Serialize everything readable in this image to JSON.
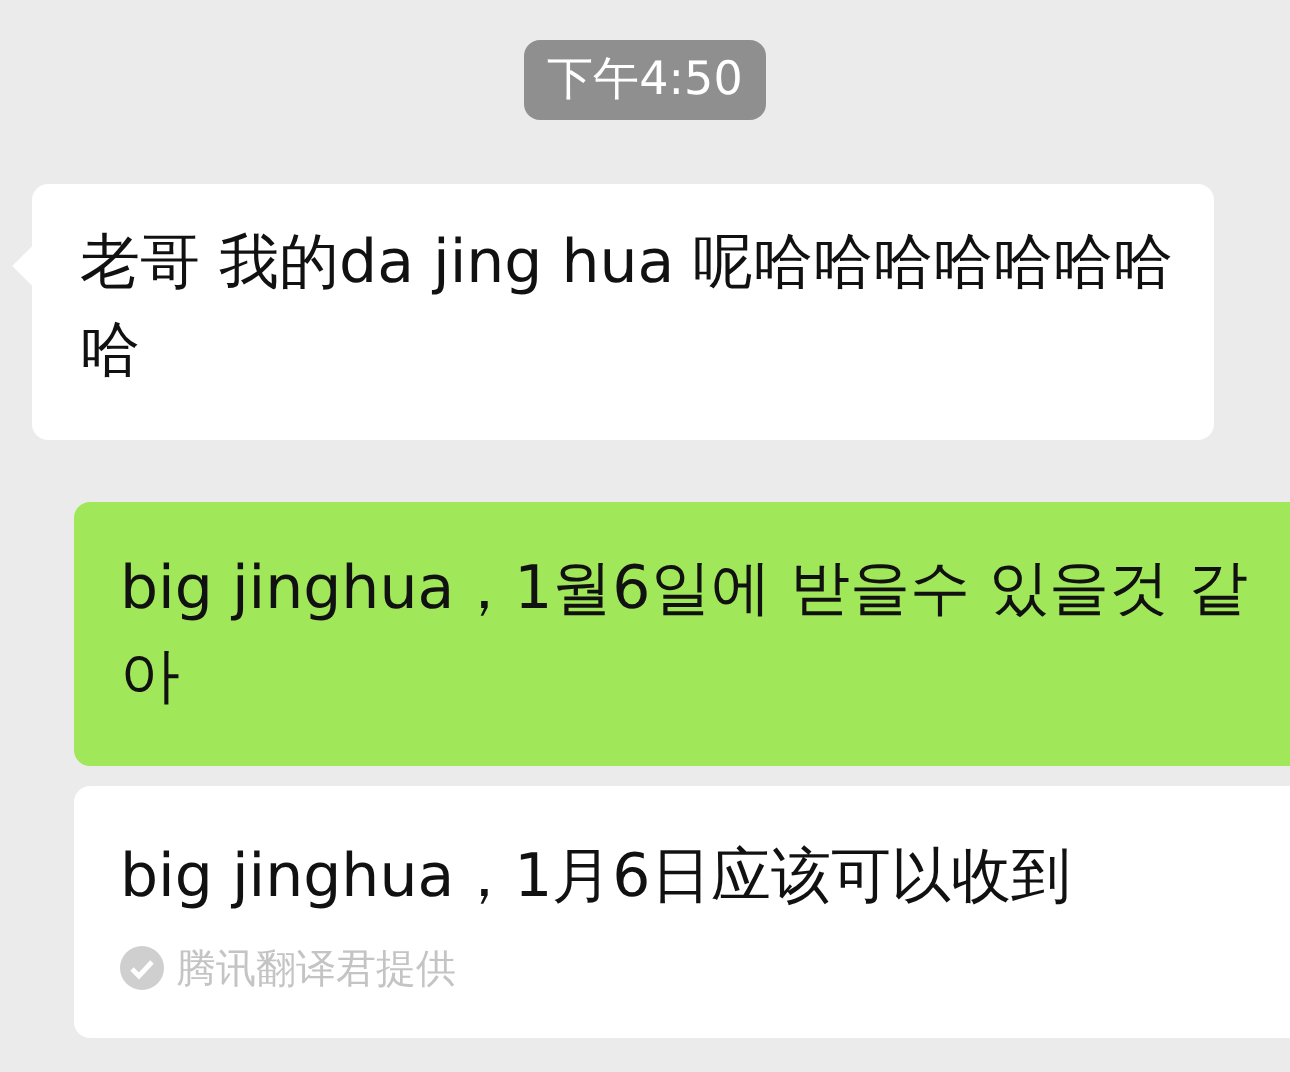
{
  "time": "下午4:50",
  "messages": [
    {
      "kind": "incoming",
      "text": "老哥 我的da jing hua 呢哈哈哈哈哈哈哈哈"
    },
    {
      "kind": "outgoing",
      "text": "big jinghua，1월6일에 받을수 있을것 같아"
    },
    {
      "kind": "translation",
      "text": "big jinghua，1月6日应该可以收到",
      "credit": "腾讯翻译君提供"
    }
  ]
}
